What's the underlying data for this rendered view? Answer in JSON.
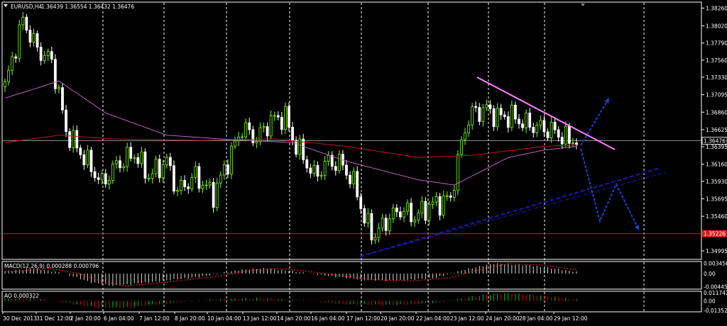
{
  "header": {
    "symbol_tf": "EURUSD,H4",
    "ohlc": "1.36439 1.36554 1.36432 1.36476"
  },
  "macd_label": "MACD(12,26,9) 0.000288 0.000796",
  "ao_label": "AO 0.000322",
  "colors": {
    "background": "#000000",
    "frame": "#ffffff",
    "grid": "#ffffff",
    "bull": "#7cfc00",
    "bear": "#ffffff",
    "ma_red": "#c0181a",
    "ma_violet": "#c060c0",
    "trend_pink": "#ff80ff",
    "trend_blue": "#1a1aa8",
    "arrow_blue": "#1e40c8",
    "level_red": "#d02020",
    "macd_signal": "#ff2020",
    "ao_up": "#00c000",
    "ao_down": "#e00000"
  },
  "chart_data": [
    {
      "type": "candlestick",
      "title": "EURUSD,H4",
      "price_ticks": [
        "1.38260",
        "1.38020",
        "1.37790",
        "1.37560",
        "1.37330",
        "1.37095",
        "1.36860",
        "1.36625",
        "1.36476",
        "1.36395",
        "1.36160",
        "1.35930",
        "1.35695",
        "1.35460",
        "1.35226",
        "1.34995"
      ],
      "current_price": "1.36476",
      "level_price": "1.35226",
      "ylim": [
        1.3488,
        1.3834
      ],
      "x_ticks": [
        "30 Dec 2013",
        "31 Dec 12:00",
        "2 Jan 20:00",
        "6 Jan 04:00",
        "7 Jan 12:00",
        "8 Jan 20:00",
        "10 Jan 04:00",
        "13 Jan 12:00",
        "14 Jan 20:00",
        "16 Jan 04:00",
        "17 Jan 12:00",
        "20 Jan 20:00",
        "22 Jan 04:00",
        "23 Jan 12:00",
        "24 Jan 20:00",
        "28 Jan 04:00",
        "29 Jan 12:00"
      ],
      "anchors": [
        {
          "bar": 0,
          "price": 1.372
        },
        {
          "bar": 3,
          "price": 1.3775
        },
        {
          "bar": 5,
          "price": 1.381
        },
        {
          "bar": 9,
          "price": 1.377
        },
        {
          "bar": 13,
          "price": 1.3755
        },
        {
          "bar": 15,
          "price": 1.371
        },
        {
          "bar": 17,
          "price": 1.366
        },
        {
          "bar": 22,
          "price": 1.3625
        },
        {
          "bar": 27,
          "price": 1.359
        },
        {
          "bar": 31,
          "price": 1.3615
        },
        {
          "bar": 36,
          "price": 1.363
        },
        {
          "bar": 40,
          "price": 1.36
        },
        {
          "bar": 45,
          "price": 1.362
        },
        {
          "bar": 48,
          "price": 1.358
        },
        {
          "bar": 53,
          "price": 1.36
        },
        {
          "bar": 58,
          "price": 1.3575
        },
        {
          "bar": 62,
          "price": 1.362
        },
        {
          "bar": 66,
          "price": 1.3665
        },
        {
          "bar": 70,
          "price": 1.365
        },
        {
          "bar": 74,
          "price": 1.3675
        },
        {
          "bar": 78,
          "price": 1.368
        },
        {
          "bar": 80,
          "price": 1.365
        },
        {
          "bar": 83,
          "price": 1.3625
        },
        {
          "bar": 86,
          "price": 1.36
        },
        {
          "bar": 90,
          "price": 1.362
        },
        {
          "bar": 94,
          "price": 1.3615
        },
        {
          "bar": 98,
          "price": 1.358
        },
        {
          "bar": 100,
          "price": 1.354
        },
        {
          "bar": 103,
          "price": 1.352
        },
        {
          "bar": 106,
          "price": 1.354
        },
        {
          "bar": 110,
          "price": 1.3555
        },
        {
          "bar": 114,
          "price": 1.3545
        },
        {
          "bar": 118,
          "price": 1.356
        },
        {
          "bar": 121,
          "price": 1.3565
        },
        {
          "bar": 124,
          "price": 1.357
        },
        {
          "bar": 126,
          "price": 1.362
        },
        {
          "bar": 128,
          "price": 1.3665
        },
        {
          "bar": 130,
          "price": 1.3685
        },
        {
          "bar": 134,
          "price": 1.369
        },
        {
          "bar": 137,
          "price": 1.368
        },
        {
          "bar": 141,
          "price": 1.368
        },
        {
          "bar": 145,
          "price": 1.367
        },
        {
          "bar": 149,
          "price": 1.3665
        },
        {
          "bar": 153,
          "price": 1.366
        },
        {
          "bar": 156,
          "price": 1.365
        },
        {
          "bar": 159,
          "price": 1.3648
        }
      ],
      "ma_red": [
        {
          "bar": 0,
          "price": 1.3645
        },
        {
          "bar": 15,
          "price": 1.3655
        },
        {
          "bar": 30,
          "price": 1.365
        },
        {
          "bar": 55,
          "price": 1.3648
        },
        {
          "bar": 75,
          "price": 1.365
        },
        {
          "bar": 95,
          "price": 1.364
        },
        {
          "bar": 115,
          "price": 1.3625
        },
        {
          "bar": 130,
          "price": 1.3628
        },
        {
          "bar": 150,
          "price": 1.364
        },
        {
          "bar": 159,
          "price": 1.3642
        }
      ],
      "ma_violet": [
        {
          "bar": 0,
          "price": 1.3705
        },
        {
          "bar": 10,
          "price": 1.372
        },
        {
          "bar": 15,
          "price": 1.3728
        },
        {
          "bar": 28,
          "price": 1.3685
        },
        {
          "bar": 45,
          "price": 1.3655
        },
        {
          "bar": 60,
          "price": 1.365
        },
        {
          "bar": 80,
          "price": 1.3645
        },
        {
          "bar": 95,
          "price": 1.362
        },
        {
          "bar": 115,
          "price": 1.3595
        },
        {
          "bar": 125,
          "price": 1.3588
        },
        {
          "bar": 140,
          "price": 1.3625
        },
        {
          "bar": 150,
          "price": 1.3635
        },
        {
          "bar": 159,
          "price": 1.364
        }
      ]
    },
    {
      "type": "bar",
      "title": "MACD(12,26,9)",
      "ticks": [
        "0.003456",
        "0.00",
        "-0.00445"
      ],
      "macd_value": "0.000288",
      "signal_value": "0.000796",
      "ylim": [
        -0.0053,
        0.0041
      ],
      "anchors": [
        {
          "bar": 0,
          "value": 0.0008
        },
        {
          "bar": 8,
          "value": 0.0018
        },
        {
          "bar": 16,
          "value": 0.0002
        },
        {
          "bar": 24,
          "value": -0.003
        },
        {
          "bar": 30,
          "value": -0.0042
        },
        {
          "bar": 40,
          "value": -0.003
        },
        {
          "bar": 55,
          "value": -0.001
        },
        {
          "bar": 65,
          "value": 0.0012
        },
        {
          "bar": 72,
          "value": 0.0018
        },
        {
          "bar": 80,
          "value": 0.0008
        },
        {
          "bar": 90,
          "value": -0.0008
        },
        {
          "bar": 100,
          "value": -0.0022
        },
        {
          "bar": 110,
          "value": -0.0024
        },
        {
          "bar": 120,
          "value": -0.0014
        },
        {
          "bar": 128,
          "value": 0.0014
        },
        {
          "bar": 136,
          "value": 0.0034
        },
        {
          "bar": 146,
          "value": 0.0028
        },
        {
          "bar": 159,
          "value": 0.0006
        }
      ]
    },
    {
      "type": "bar",
      "title": "AO",
      "ticks": [
        "0.011742",
        "0.00",
        "-0.01352"
      ],
      "value": "0.000322",
      "ylim": [
        -0.0155,
        0.0135
      ],
      "anchors": [
        {
          "bar": 0,
          "value": 0.003
        },
        {
          "bar": 8,
          "value": 0.004
        },
        {
          "bar": 16,
          "value": -0.002
        },
        {
          "bar": 26,
          "value": -0.01
        },
        {
          "bar": 34,
          "value": -0.0095
        },
        {
          "bar": 46,
          "value": -0.003
        },
        {
          "bar": 58,
          "value": 0.002
        },
        {
          "bar": 70,
          "value": 0.004
        },
        {
          "bar": 82,
          "value": 0.001
        },
        {
          "bar": 96,
          "value": -0.005
        },
        {
          "bar": 108,
          "value": -0.006
        },
        {
          "bar": 120,
          "value": -0.003
        },
        {
          "bar": 130,
          "value": 0.006
        },
        {
          "bar": 138,
          "value": 0.011
        },
        {
          "bar": 148,
          "value": 0.008
        },
        {
          "bar": 159,
          "value": 0.002
        }
      ]
    }
  ]
}
